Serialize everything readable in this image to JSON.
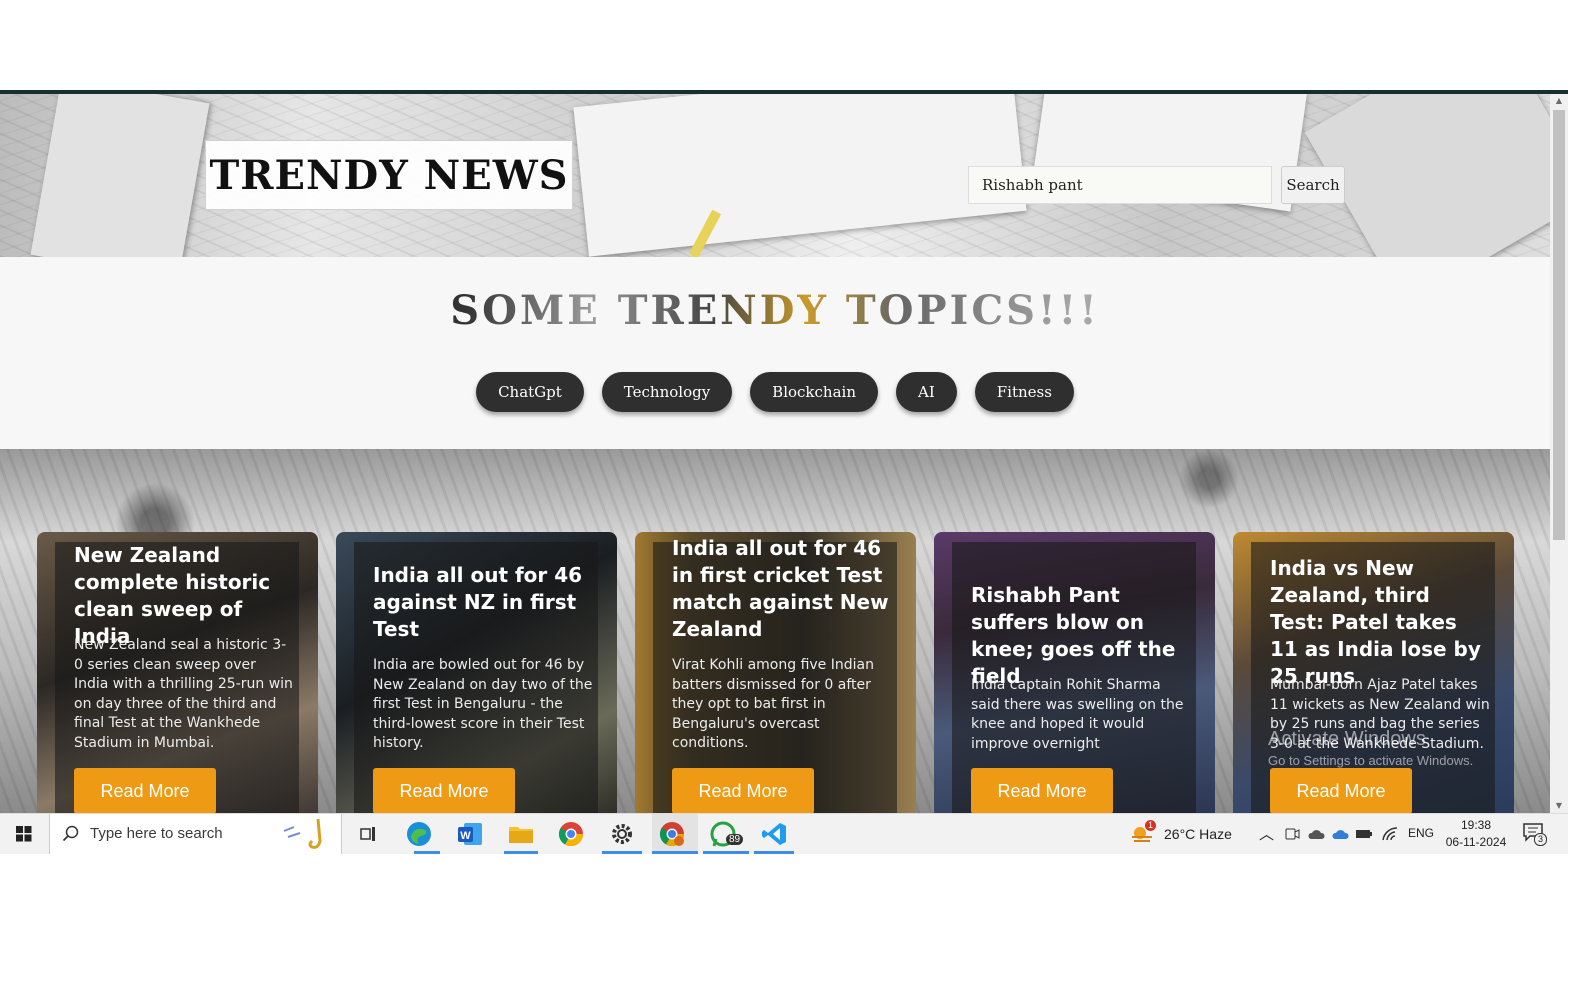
{
  "site": {
    "logo": "TRENDY NEWS",
    "search": {
      "value": "Rishabh pant",
      "button": "Search"
    }
  },
  "trending": {
    "title": "SOME TRENDY TOPICS!!!",
    "topics": [
      "ChatGpt",
      "Technology",
      "Blockchain",
      "AI",
      "Fitness"
    ]
  },
  "cards": [
    {
      "title": "New Zealand complete historic clean sweep of India",
      "body": "New Zealand seal a historic 3-0 series clean sweep over India with a thrilling 25-run win on day three of the third and final Test at the Wankhede Stadium in Mumbai.",
      "button": "Read More"
    },
    {
      "title": "India all out for 46 against NZ in first Test",
      "body": "India are bowled out for 46 by New Zealand on day two of the first Test in Bengaluru - the third-lowest score in their Test history.",
      "button": "Read More"
    },
    {
      "title": "India all out for 46 in first cricket Test match against New Zealand",
      "body": "Virat Kohli among five Indian batters dismissed for 0 after they opt to bat first in Bengaluru's overcast conditions.",
      "button": "Read More"
    },
    {
      "title": "Rishabh Pant suffers blow on knee; goes off the field",
      "body": "India captain Rohit Sharma said there was swelling on the knee and hoped it would improve overnight",
      "button": "Read More"
    },
    {
      "title": "India vs New Zealand, third Test: Patel takes 11 as India lose by 25 runs",
      "body": "Mumbai-born Ajaz Patel takes 11 wickets as New Zealand win by 25 runs and bag the series 3-0 at the Wankhede Stadium.",
      "button": "Read More"
    }
  ],
  "watermark": {
    "line1": "Activate Windows",
    "line2": "Go to Settings to activate Windows."
  },
  "taskbar": {
    "search_placeholder": "Type here to search",
    "whatsapp_badge": "89",
    "weather": "26°C  Haze",
    "weather_badge": "1",
    "language": "ENG",
    "time": "19:38",
    "date": "06-11-2024",
    "notification_count": "3"
  },
  "colors": {
    "accent": "#ef9a15",
    "chip": "#2f2f2f",
    "header_border": "#17302f"
  }
}
